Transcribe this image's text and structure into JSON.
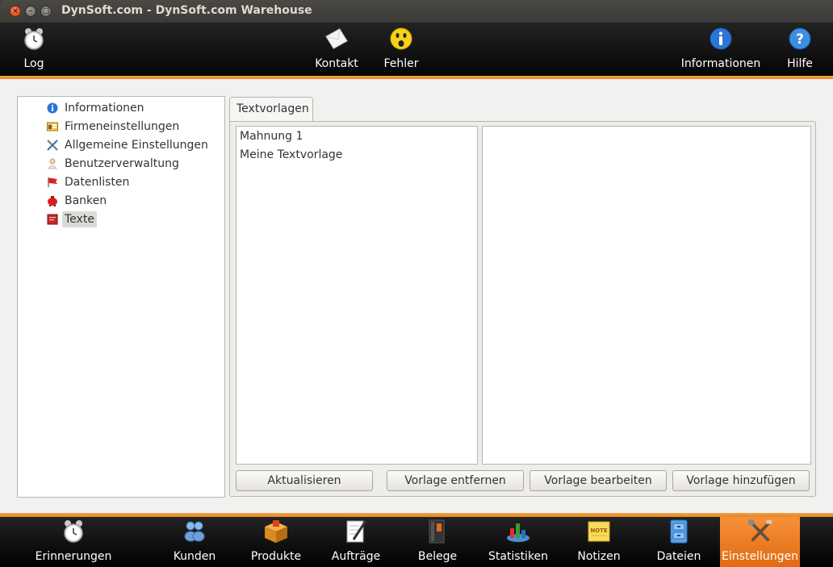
{
  "window": {
    "title": "DynSoft.com - DynSoft.com Warehouse"
  },
  "toolbar": {
    "log": "Log",
    "kontakt": "Kontakt",
    "fehler": "Fehler",
    "informationen": "Informationen",
    "hilfe": "Hilfe"
  },
  "tree": {
    "items": [
      {
        "label": "Informationen",
        "icon": "info-icon"
      },
      {
        "label": "Firmeneinstellungen",
        "icon": "company-icon"
      },
      {
        "label": "Allgemeine Einstellungen",
        "icon": "tools-icon"
      },
      {
        "label": "Benutzerverwaltung",
        "icon": "user-icon"
      },
      {
        "label": "Datenlisten",
        "icon": "flag-icon"
      },
      {
        "label": "Banken",
        "icon": "piggy-bank-icon"
      },
      {
        "label": "Texte",
        "icon": "book-icon",
        "selected": true
      }
    ]
  },
  "tab": {
    "label": "Textvorlagen"
  },
  "templates": [
    "Mahnung 1",
    "Meine Textvorlage"
  ],
  "buttons": {
    "refresh": "Aktualisieren",
    "remove": "Vorlage entfernen",
    "edit": "Vorlage bearbeiten",
    "add": "Vorlage hinzufügen"
  },
  "nav": [
    {
      "label": "Erinnerungen",
      "icon": "alarm-clock-icon"
    },
    {
      "label": "Kunden",
      "icon": "customers-icon"
    },
    {
      "label": "Produkte",
      "icon": "box-icon"
    },
    {
      "label": "Aufträge",
      "icon": "pen-paper-icon"
    },
    {
      "label": "Belege",
      "icon": "binder-icon"
    },
    {
      "label": "Statistiken",
      "icon": "chart-icon"
    },
    {
      "label": "Notizen",
      "icon": "note-icon"
    },
    {
      "label": "Dateien",
      "icon": "cabinet-icon"
    },
    {
      "label": "Einstellungen",
      "icon": "tools-icon",
      "active": true
    }
  ],
  "note_icon_text": "NOTE",
  "colors": {
    "accent": "#e98a24",
    "toolbar": "#111111"
  }
}
